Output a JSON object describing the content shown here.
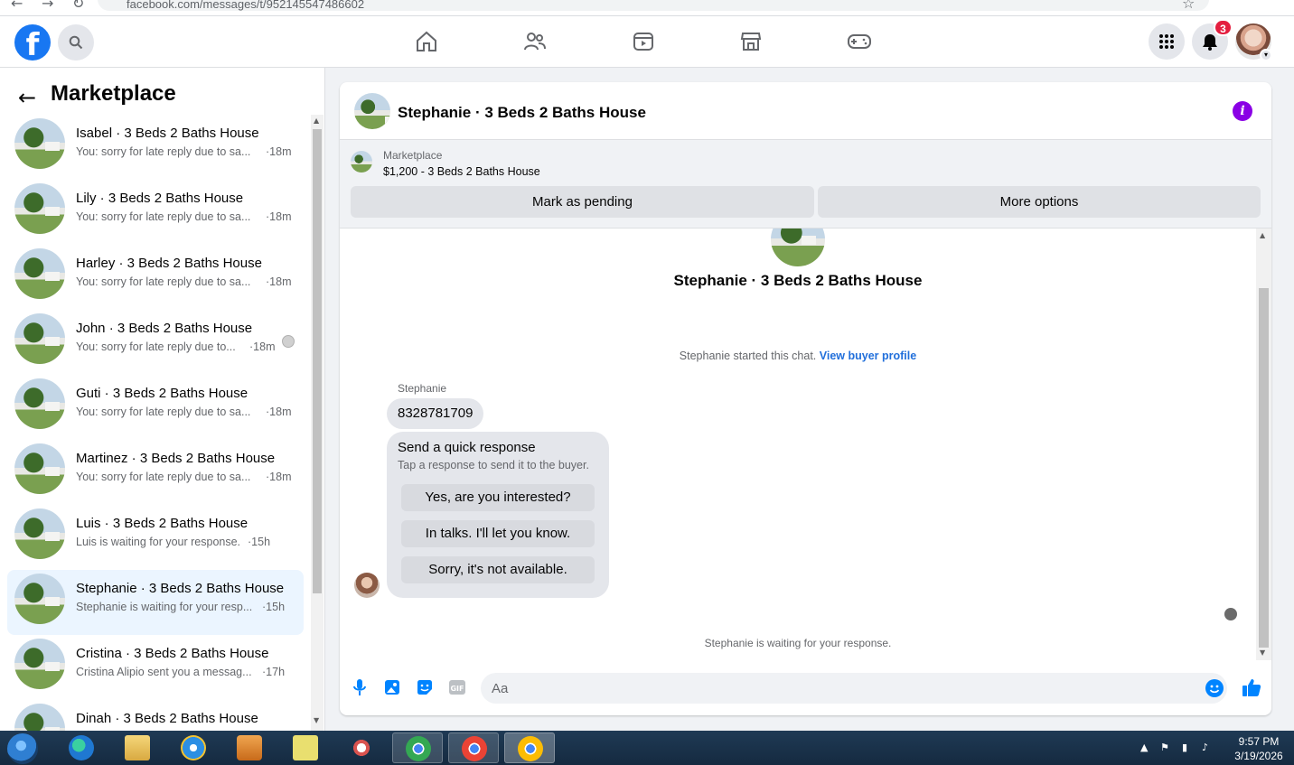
{
  "browser": {
    "url": "facebook.com/messages/t/952145547486602"
  },
  "topnav": {
    "logo": "f",
    "notifications_count": "3",
    "nav_icons": [
      "home-icon",
      "friends-icon",
      "watch-icon",
      "marketplace-icon",
      "gaming-icon"
    ]
  },
  "left_panel": {
    "title": "Marketplace",
    "conversations": [
      {
        "name": "Isabel · 3 Beds 2 Baths House",
        "preview": "You: sorry for late reply due to sa...",
        "time": "·18m"
      },
      {
        "name": "Lily · 3 Beds 2 Baths House",
        "preview": "You: sorry for late reply due to sa...",
        "time": "·18m"
      },
      {
        "name": "Harley · 3 Beds 2 Baths House",
        "preview": "You: sorry for late reply due to sa...",
        "time": "·18m"
      },
      {
        "name": "John · 3 Beds 2 Baths House",
        "preview": "You: sorry for late reply due to...",
        "time": "·18m"
      },
      {
        "name": "Guti · 3 Beds 2 Baths House",
        "preview": "You: sorry for late reply due to sa...",
        "time": "·18m"
      },
      {
        "name": "Martinez · 3 Beds 2 Baths House",
        "preview": "You: sorry for late reply due to sa...",
        "time": "·18m"
      },
      {
        "name": "Luis · 3 Beds 2 Baths House",
        "preview": "Luis is waiting for your response.",
        "time": "·15h"
      },
      {
        "name": "Stephanie · 3 Beds 2 Baths House",
        "preview": "Stephanie is waiting for your resp...",
        "time": "·15h"
      },
      {
        "name": "Cristina · 3 Beds 2 Baths House",
        "preview": "Cristina Alipio sent you a messag...",
        "time": "·17h"
      },
      {
        "name": "Dinah · 3 Beds 2 Baths House",
        "preview": "",
        "time": ""
      }
    ]
  },
  "chat": {
    "title": "Stephanie · 3 Beds 2 Baths House",
    "marketplace_label": "Marketplace",
    "listing": "$1,200 - 3 Beds 2 Baths House",
    "mark_pending": "Mark as pending",
    "more_options": "More options",
    "center_title": "Stephanie · 3 Beds 2 Baths House",
    "started_text": "Stephanie started this chat.",
    "view_profile": "View buyer profile",
    "sender_name": "Stephanie",
    "phone_message": "8328781709",
    "quick_title": "Send a quick response",
    "quick_subtitle": "Tap a response to send it to the buyer.",
    "quick_responses": [
      "Yes, are you interested?",
      "In talks. I'll let you know.",
      "Sorry, it's not available."
    ],
    "waiting_text": "Stephanie is waiting for your response.",
    "composer_placeholder": "Aa"
  },
  "taskbar": {
    "time": "9:57 PM",
    "date": "3/19/2026"
  },
  "colors": {
    "brand": "#1877f2",
    "accent": "#0084ff",
    "info": "#8a00e5",
    "badge": "#e41e3f"
  }
}
